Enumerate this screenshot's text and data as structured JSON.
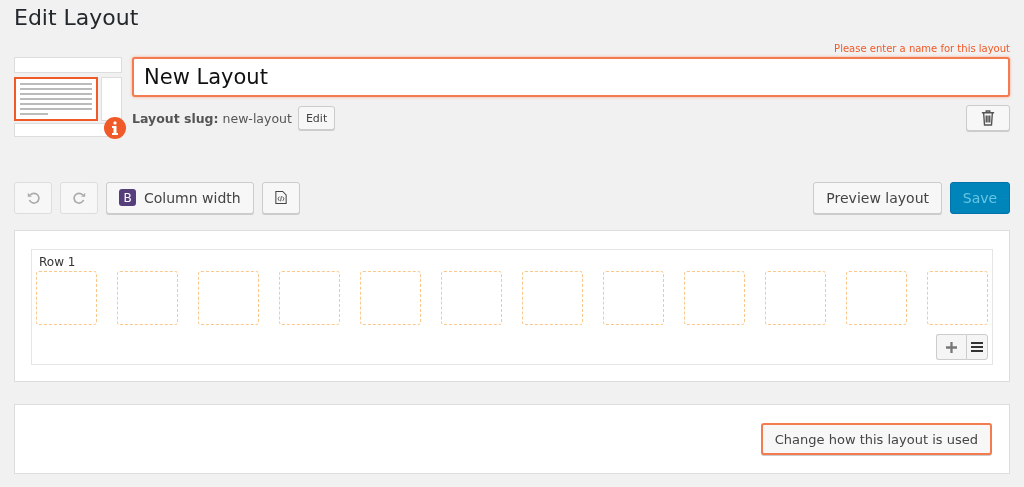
{
  "page_title": "Edit Layout",
  "name_field": {
    "value": "New Layout",
    "error": "Please enter a name for this layout",
    "invalid": true
  },
  "slug": {
    "label": "Layout slug:",
    "value": "new-layout",
    "edit_button": "Edit"
  },
  "toolbar": {
    "undo_disabled": true,
    "redo_disabled": true,
    "column_width_badge": "B",
    "column_width_label": "Column width",
    "preview_button": "Preview layout",
    "save_button": "Save",
    "save_disabled": true
  },
  "rows": [
    {
      "title": "Row 1",
      "cells": [
        {
          "kind": "empty"
        },
        {
          "kind": "empty"
        },
        {
          "kind": "empty"
        },
        {
          "kind": "empty"
        },
        {
          "kind": "empty"
        },
        {
          "kind": "empty"
        },
        {
          "kind": "empty"
        },
        {
          "kind": "empty"
        },
        {
          "kind": "empty"
        },
        {
          "kind": "empty"
        },
        {
          "kind": "empty"
        },
        {
          "kind": "empty"
        }
      ]
    }
  ],
  "usage_button": "Change how this layout is used"
}
